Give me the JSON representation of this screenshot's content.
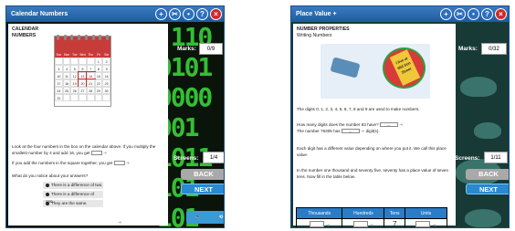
{
  "left_panel": {
    "title": "Calendar Numbers",
    "heading": "CALENDAR NUMBERS",
    "bg_digits": "  110\n 0101\n 0000\n1001\n 1011\n 101\n 101",
    "calendar": {
      "days": [
        "Sun",
        "Mon",
        "Tue",
        "Wed",
        "Thu",
        "Fri",
        "Sat"
      ],
      "rows": [
        [
          "",
          "",
          "",
          "",
          "",
          "1",
          "2"
        ],
        [
          "3",
          "4",
          "5",
          "6",
          "7",
          "8",
          "9"
        ],
        [
          "10",
          "11",
          "12",
          "13",
          "14",
          "15",
          "16"
        ],
        [
          "17",
          "18",
          "19",
          "20",
          "21",
          "22",
          "23"
        ],
        [
          "24",
          "25",
          "26",
          "27",
          "28",
          "29",
          "30"
        ],
        [
          "31",
          "",
          "",
          "",
          "",
          "",
          ""
        ]
      ]
    },
    "instruction": "Look at the four numbers in the box on the calendar above. If you multiply the smallest number by 4 and add 16, you get",
    "question2": "If you add the numbers in the square together, you get",
    "question3": "What do you notice about your answers?",
    "options": [
      "There is a difference of two.",
      "There is a difference of one.",
      "They are the same."
    ],
    "marks_label": "Marks:",
    "marks_value": "0/9",
    "screens_label": "Screens:",
    "screens_value": "1/4",
    "back_label": "BACK",
    "next_label": "NEXT"
  },
  "right_panel": {
    "title": "Place Value +",
    "heading": "NUMBER PROPERTIES",
    "subheading": "Writing Numbers",
    "sign_text": "I live at 653 Son Street",
    "para1": "The digits 0, 1, 2, 3, 4, 5, 6, 7, 8 and 9 are used to make numbers.",
    "q1": "How many digits does the number 63 have?",
    "q2_pre": "The number 76305 has",
    "q2_post": "digit(s).",
    "select_placeholder": "---",
    "para2": "Each digit has a different value depending on where you put it. We call this place value.",
    "para3": "In the number one thousand and seventy five, seventy has a place value of seven tens. Now fill in the table below.",
    "table_headers": [
      "Thousands",
      "Hundreds",
      "Tens",
      "Units"
    ],
    "tens_value": "7",
    "marks_label": "Marks:",
    "marks_value": "0/32",
    "screens_label": "Screens:",
    "screens_value": "1/11",
    "back_label": "BACK",
    "next_label": "NEXT"
  },
  "colors": {
    "titlebar": "#1e5c9e",
    "next": "#2a89cf",
    "back": "#a9a9a9",
    "digits": "#3ddc3d",
    "close": "#d02a2a"
  },
  "icons": [
    "plus-icon",
    "scissors-icon",
    "dots-icon",
    "help-icon",
    "close-icon",
    "speaker-icon",
    "replay-icon"
  ]
}
